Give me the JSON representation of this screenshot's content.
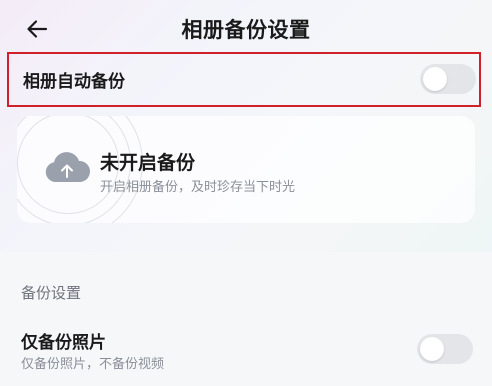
{
  "header": {
    "back_icon": "arrow-left-icon",
    "title": "相册备份设置"
  },
  "auto_backup": {
    "label": "相册自动备份",
    "enabled": false,
    "highlight_color": "#d0202a"
  },
  "status_card": {
    "icon": "cloud-upload-icon",
    "title": "未开启备份",
    "subtitle": "开启相册备份，及时珍存当下时光"
  },
  "backup_settings": {
    "section_label": "备份设置",
    "photo_only": {
      "title": "仅备份照片",
      "description": "仅备份照片，不备份视频",
      "enabled": false
    }
  },
  "colors": {
    "toggle_off": "#e3e5e9",
    "cloud_icon": "#9aa1ac",
    "secondary_text": "#8a8f99"
  }
}
